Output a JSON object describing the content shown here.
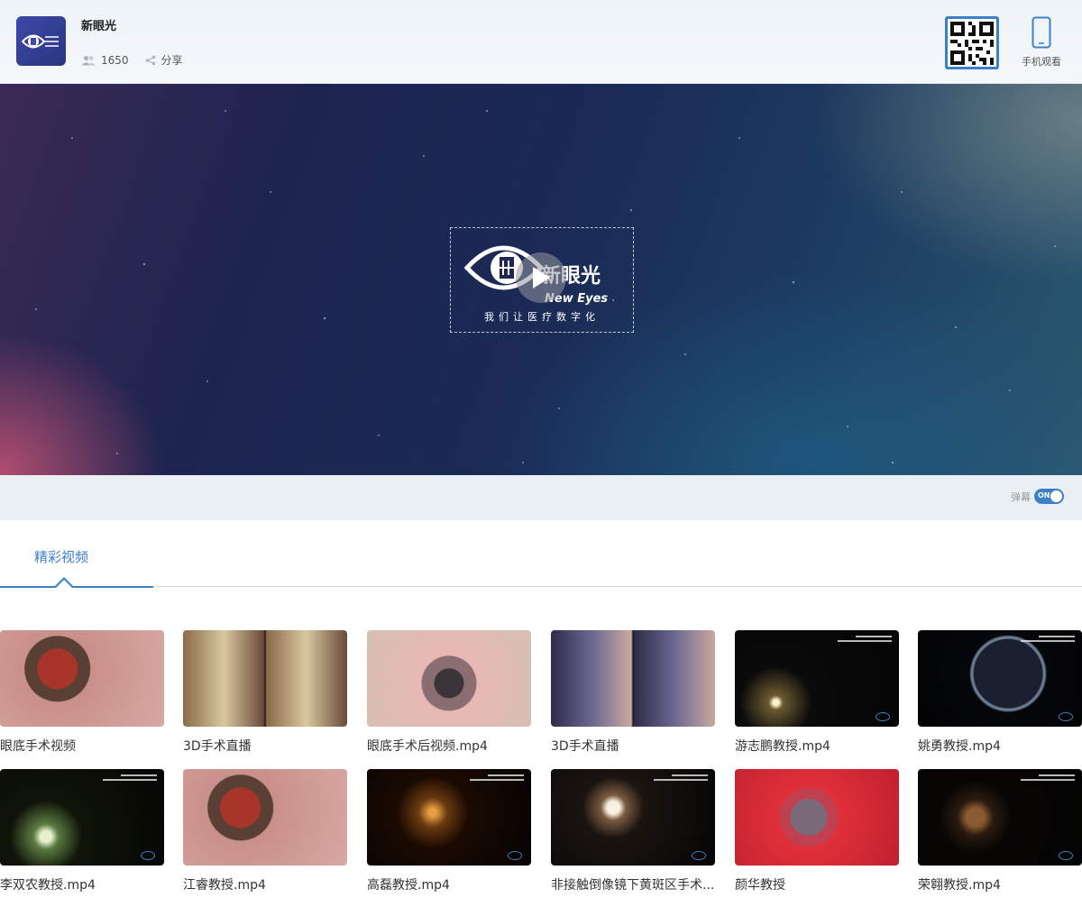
{
  "header": {
    "channel_name": "新眼光",
    "viewers": "1650",
    "share_label": "分享",
    "mobile_label": "手机观看"
  },
  "player": {
    "poster_brand": "新眼光",
    "poster_brand_en": "New Eyes",
    "poster_slogan": "我们让医疗数字化"
  },
  "controls": {
    "danmu_label": "弹幕",
    "danmu_state": "ON"
  },
  "tabs": [
    {
      "label": "精彩视频",
      "active": true
    }
  ],
  "videos": [
    {
      "title": "眼底手术视频",
      "style": "eye-red"
    },
    {
      "title": "3D手术直播",
      "style": "split-tissue"
    },
    {
      "title": "眼底手术后视频.mp4",
      "style": "eye-pink"
    },
    {
      "title": "3D手术直播",
      "style": "split-iris"
    },
    {
      "title": "游志鹏教授.mp4",
      "style": "dark-light"
    },
    {
      "title": "姚勇教授.mp4",
      "style": "dark-ring"
    },
    {
      "title": "李双农教授.mp4",
      "style": "dark-glow"
    },
    {
      "title": "江睿教授.mp4",
      "style": "eye-red"
    },
    {
      "title": "高磊教授.mp4",
      "style": "dark-amber"
    },
    {
      "title": "非接触倒像镜下黄斑区手术...",
      "style": "dark-spot"
    },
    {
      "title": "颜华教授",
      "style": "eye-bright-red"
    },
    {
      "title": "荣翱教授.mp4",
      "style": "dark-small"
    }
  ],
  "colors": {
    "accent": "#3c80c8",
    "header_bg": "#eef3f8",
    "controls_bg": "#eaeff3"
  }
}
